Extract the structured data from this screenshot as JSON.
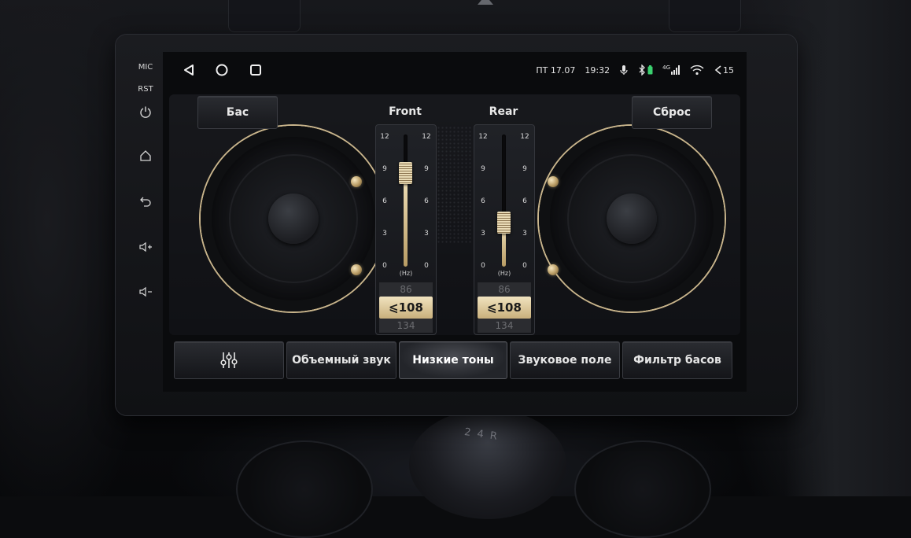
{
  "sidebar": {
    "mic_label": "MIC",
    "rst_label": "RST"
  },
  "statusbar": {
    "day": "ПТ",
    "date": "17.07",
    "time": "19:32",
    "network": "4G",
    "volume": "15"
  },
  "header": {
    "left_button": "Бас",
    "right_button": "Сброс"
  },
  "sliders": [
    {
      "title": "Front",
      "scale": [
        "12",
        "9",
        "6",
        "3",
        "0"
      ],
      "level": 8.5,
      "unit": "(Hz)",
      "prev_freq": "86",
      "current_freq": "⩽108",
      "next_freq": "134"
    },
    {
      "title": "Rear",
      "scale": [
        "12",
        "9",
        "6",
        "3",
        "0"
      ],
      "level": 4,
      "unit": "(Hz)",
      "prev_freq": "86",
      "current_freq": "⩽108",
      "next_freq": "134"
    }
  ],
  "tabs": [
    {
      "label": "",
      "icon": "equalizer-icon"
    },
    {
      "label": "Объемный звук"
    },
    {
      "label": "Низкие тоны",
      "active": true
    },
    {
      "label": "Звуковое поле"
    },
    {
      "label": "Фильтр басов"
    }
  ],
  "colors": {
    "accent_gold": "#c9b07c",
    "background": "#0a0b0d"
  }
}
